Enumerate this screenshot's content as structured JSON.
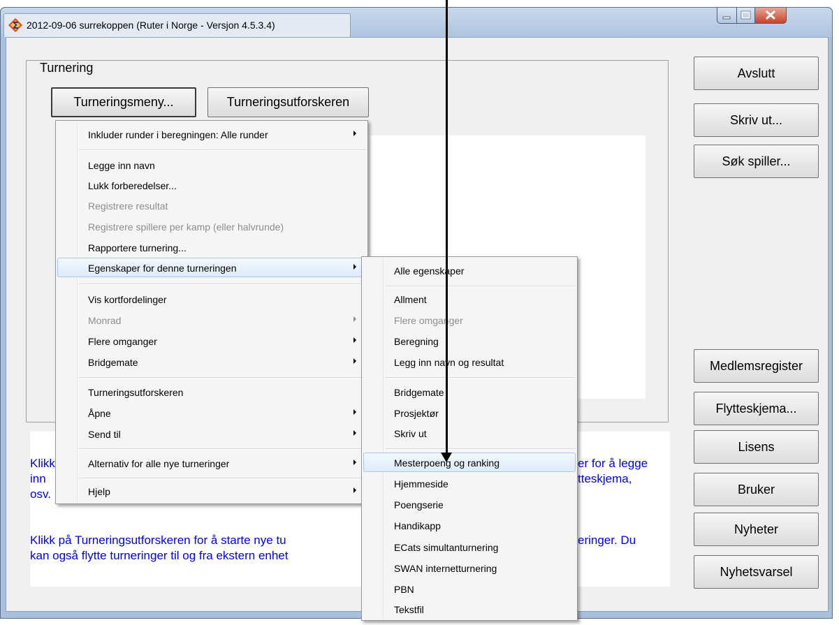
{
  "window": {
    "title": "2012-09-06  surrekoppen  (Ruter i Norge - Versjon 4.5.3.4)"
  },
  "group": {
    "label": "Turnering"
  },
  "buttons": {
    "turneringsmeny": "Turneringsmeny...",
    "turneringsutforskeren": "Turneringsutforskeren",
    "avslutt": "Avslutt",
    "skriv_ut": "Skriv ut...",
    "sok_spiller": "Søk spiller...",
    "medlemsregister": "Medlemsregister",
    "flytteskjema": "Flytteskjema...",
    "lisens": "Lisens",
    "bruker": "Bruker",
    "nyheter": "Nyheter",
    "nyhetsvarsel": "Nyhetsvarsel"
  },
  "info": {
    "line1_start": "Klikk",
    "line1_end": "er for å legge",
    "line2_start": "inn",
    "line2_end": "tteskjema,",
    "line3_start": "osv.",
    "line4": "Klikk på Turneringsutforskeren for å starte nye tu",
    "line4_end": "eringer. Du",
    "line5": "kan også flytte turneringer til og fra ekstern enhet"
  },
  "menu_main": {
    "items": [
      {
        "label": "Inkluder runder i beregningen:   Alle runder"
      },
      {
        "label": "Legge inn navn"
      },
      {
        "label": "Lukk forberedelser..."
      },
      {
        "label": "Registrere resultat"
      },
      {
        "label": "Registrere spillere per kamp (eller halvrunde)"
      },
      {
        "label": "Rapportere turnering..."
      },
      {
        "label": "Egenskaper for denne turneringen"
      },
      {
        "label": "Vis kortfordelinger"
      },
      {
        "label": "Monrad"
      },
      {
        "label": "Flere omganger"
      },
      {
        "label": "Bridgemate"
      },
      {
        "label": "Turneringsutforskeren"
      },
      {
        "label": "Åpne"
      },
      {
        "label": "Send til"
      },
      {
        "label": "Alternativ for alle nye turneringer"
      },
      {
        "label": "Hjelp"
      }
    ]
  },
  "menu_sub": {
    "items": [
      {
        "label": "Alle egenskaper"
      },
      {
        "label": "Allment"
      },
      {
        "label": "Flere omganger"
      },
      {
        "label": "Beregning"
      },
      {
        "label": "Legg inn navn og resultat"
      },
      {
        "label": "Bridgemate"
      },
      {
        "label": "Prosjektør"
      },
      {
        "label": "Skriv ut"
      },
      {
        "label": "Mesterpoeng og ranking"
      },
      {
        "label": "Hjemmeside"
      },
      {
        "label": "Poengserie"
      },
      {
        "label": "Handikapp"
      },
      {
        "label": "ECats simultanturnering"
      },
      {
        "label": "SWAN internetturnering"
      },
      {
        "label": "PBN"
      },
      {
        "label": "Tekstfil"
      }
    ]
  },
  "colors": {
    "info_text": "#0000ee",
    "highlight_border": "#a8c8ee"
  }
}
